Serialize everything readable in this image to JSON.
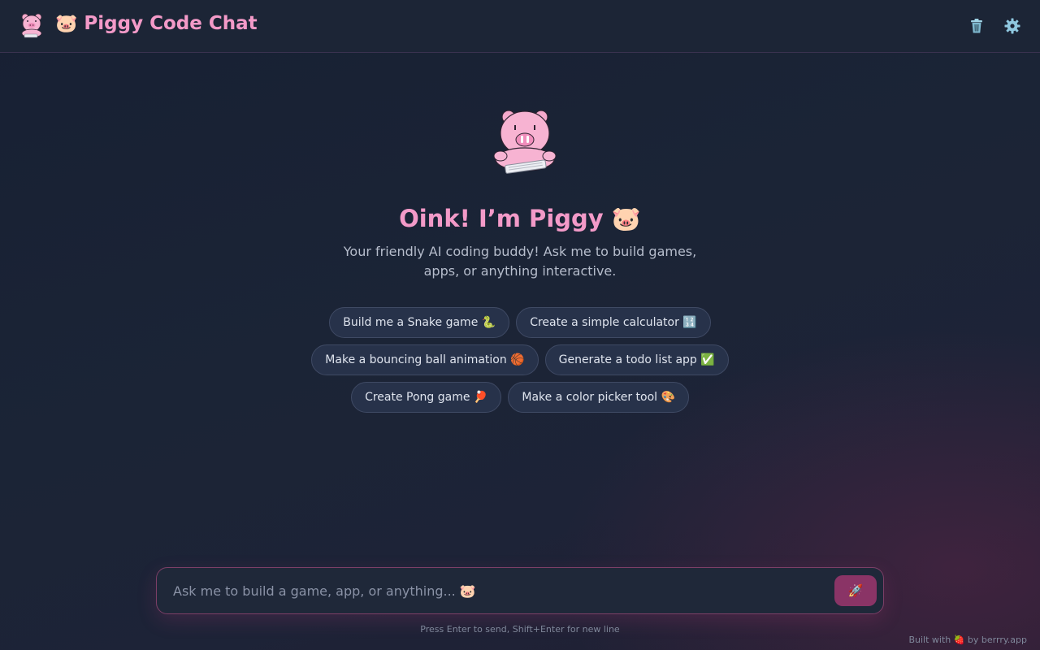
{
  "header": {
    "title": "Piggy Code Chat",
    "title_emoji": "🐷",
    "logo_icon": "pig-mascot-icon",
    "clear_icon": "trash-icon",
    "settings_icon": "gear-icon"
  },
  "hero": {
    "title": "Oink! I’m Piggy 🐷",
    "subtitle": "Your friendly AI coding buddy! Ask me to build games, apps, or anything interactive."
  },
  "suggestions": [
    "Build me a Snake game 🐍",
    "Create a simple calculator 🔢",
    "Make a bouncing ball animation 🏀",
    "Generate a todo list app ✅",
    "Create Pong game 🏓",
    "Make a color picker tool 🎨"
  ],
  "input": {
    "placeholder": "Ask me to build a game, app, or anything... 🐷",
    "value": "",
    "send_icon": "rocket-icon",
    "send_glyph": "🚀"
  },
  "hint": "Press Enter to send, Shift+Enter for new line",
  "footer": {
    "built_with": "Built with 🍓 by berrry.app"
  },
  "colors": {
    "accent": "#f39ac8",
    "send_button": "#8a3466",
    "background": "#1b2436"
  }
}
